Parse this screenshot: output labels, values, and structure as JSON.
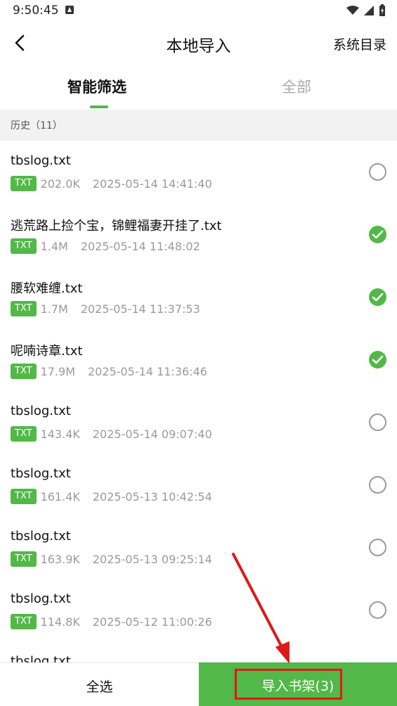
{
  "status_bar": {
    "time": "9:50:45"
  },
  "header": {
    "title": "本地导入",
    "right_action": "系统目录"
  },
  "tabs": [
    {
      "label": "智能筛选",
      "active": true
    },
    {
      "label": "全部",
      "active": false
    }
  ],
  "section": {
    "label": "历史（11）"
  },
  "files": [
    {
      "name": "tbslog.txt",
      "type": "TXT",
      "size": "202.0K",
      "date": "2025-05-14 14:41:40",
      "checked": false
    },
    {
      "name": "逃荒路上捡个宝，锦鲤福妻开挂了.txt",
      "type": "TXT",
      "size": "1.4M",
      "date": "2025-05-14 11:48:02",
      "checked": true
    },
    {
      "name": "腰软难缠.txt",
      "type": "TXT",
      "size": "1.7M",
      "date": "2025-05-14 11:37:53",
      "checked": true
    },
    {
      "name": "呢喃诗章.txt",
      "type": "TXT",
      "size": "17.9M",
      "date": "2025-05-14 11:36:46",
      "checked": true
    },
    {
      "name": "tbslog.txt",
      "type": "TXT",
      "size": "143.4K",
      "date": "2025-05-14 09:07:40",
      "checked": false
    },
    {
      "name": "tbslog.txt",
      "type": "TXT",
      "size": "161.4K",
      "date": "2025-05-13 10:42:54",
      "checked": false
    },
    {
      "name": "tbslog.txt",
      "type": "TXT",
      "size": "163.9K",
      "date": "2025-05-13 09:25:14",
      "checked": false
    },
    {
      "name": "tbslog.txt",
      "type": "TXT",
      "size": "114.8K",
      "date": "2025-05-12 11:00:26",
      "checked": false
    },
    {
      "name": "tbslog.txt",
      "type": "TXT",
      "size": "",
      "date": "",
      "checked": false
    }
  ],
  "bottom": {
    "select_all": "全选",
    "import": "导入书架(3)"
  },
  "colors": {
    "accent": "#52b848",
    "highlight": "#e01818"
  }
}
